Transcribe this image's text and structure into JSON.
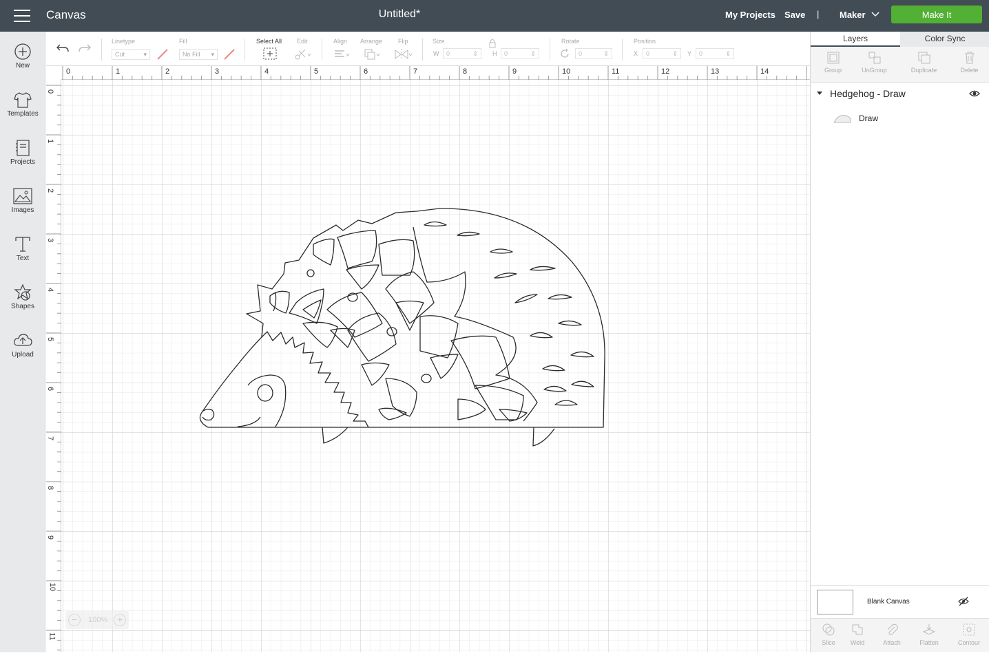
{
  "topbar": {
    "app_title": "Canvas",
    "doc_title": "Untitled*",
    "my_projects": "My Projects",
    "save": "Save",
    "divider": "|",
    "machine": "Maker",
    "make_it": "Make It"
  },
  "sidebar": {
    "items": [
      {
        "label": "New",
        "icon": "plus-circle-icon"
      },
      {
        "label": "Templates",
        "icon": "tshirt-icon"
      },
      {
        "label": "Projects",
        "icon": "projects-icon"
      },
      {
        "label": "Images",
        "icon": "image-icon"
      },
      {
        "label": "Text",
        "icon": "text-icon"
      },
      {
        "label": "Shapes",
        "icon": "shapes-icon"
      },
      {
        "label": "Upload",
        "icon": "upload-cloud-icon"
      }
    ]
  },
  "toolbar": {
    "linetype_label": "Linetype",
    "linetype_value": "Cut",
    "fill_label": "Fill",
    "fill_value": "No Fill",
    "select_all": "Select All",
    "edit": "Edit",
    "align": "Align",
    "arrange": "Arrange",
    "flip": "Flip",
    "size": "Size",
    "w": "W",
    "w_value": "0",
    "h": "H",
    "h_value": "0",
    "rotate": "Rotate",
    "rotate_value": "0",
    "position": "Position",
    "x": "X",
    "x_value": "0",
    "y": "Y",
    "y_value": "0"
  },
  "canvas": {
    "ruler_top": [
      "0",
      "1",
      "2",
      "3",
      "4",
      "5",
      "6",
      "7",
      "8",
      "9",
      "10",
      "11",
      "12",
      "13",
      "14"
    ],
    "ruler_left": [
      "0",
      "1",
      "2",
      "3",
      "4",
      "5",
      "6",
      "7",
      "8",
      "9",
      "10",
      "11"
    ],
    "zoom_level": "100%",
    "zoom_out": "−",
    "zoom_in": "+"
  },
  "panel": {
    "tabs": [
      "Layers",
      "Color Sync"
    ],
    "actions": [
      "Group",
      "UnGroup",
      "Duplicate",
      "Delete"
    ],
    "group_name": "Hedgehog - Draw",
    "layer_name": "Draw",
    "blank_canvas": "Blank Canvas",
    "bottom_actions": [
      "Slice",
      "Weld",
      "Attach",
      "Flatten",
      "Contour"
    ]
  },
  "colors": {
    "topbar": "#414c55",
    "accent_green": "#52b035",
    "sidebar": "#e8e9ea"
  }
}
